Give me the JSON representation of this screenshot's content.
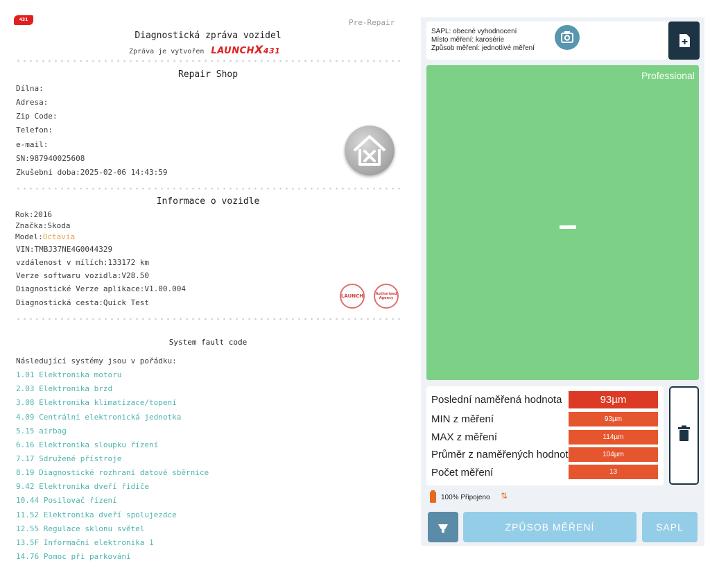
{
  "report": {
    "logo_badge": "431",
    "pre_repair": "Pre-Repair",
    "title": "Diagnostická zpráva vozidel",
    "subtitle": "Zpráva je vytvořen",
    "brand": "LAUNCH",
    "brand_x": "X",
    "brand_num": "431",
    "shop": {
      "title": "Repair Shop",
      "dilna": "Dílna:",
      "adresa": "Adresa:",
      "zip": "Zip Code:",
      "telefon": "Telefon:",
      "email": "e-mail:",
      "sn": "SN:987940025608",
      "test_time": "Zkušební doba:2025-02-06 14:43:59"
    },
    "vehicle": {
      "title": "Informace o vozidle",
      "year": "Rok:2016",
      "make": "Značka:Skoda",
      "model_label": "Model:",
      "model_value": "Octavia",
      "vin": "VIN:TMBJ37NE4G0044329",
      "distance": "vzdálenost v mílích:133172 km",
      "software": "Verze softwaru vozidla:V28.50",
      "app_version": "Diagnostické Verze aplikace:V1.00.004",
      "path": "Diagnostická cesta:Quick Test"
    },
    "stamps": [
      "LAUNCH",
      "Authorized Agency"
    ],
    "faults": {
      "title": "System fault code",
      "intro": "Následující systémy jsou v pořádku:",
      "items": [
        "1.01 Elektronika motoru",
        "2.03 Elektronika brzd",
        "3.08 Elektronika klimatizace/topení",
        "4.09 Centrální elektronická jednotka",
        "5.15 airbag",
        "6.16 Elektronika sloupku řízení",
        "7.17 Sdružené přístroje",
        "8.19 Diagnostické rozhraní datové sběrnice",
        "9.42 Elektronika dveří řidiče",
        "10.44 Posilovač řízení",
        "11.52 Elektronika dveří spolujezdce",
        "12.55 Regulace sklonu světel",
        "13.5F Informační elektronika 1",
        "14.76 Pomoc při parkování"
      ]
    }
  },
  "panel": {
    "info": {
      "line1": "SAPL: obecné vyhodnocení",
      "line2": "Místo měření: karosérie",
      "line3": "Způsob měření: jednotlivé měření"
    },
    "mode_label": "Professional",
    "current_reading": "–",
    "stats": {
      "last_label": "Poslední naměřená hodnota",
      "last_value": "93µm",
      "min_label": "MIN z měření",
      "min_value": "93µm",
      "max_label": "MAX z měření",
      "max_value": "114µm",
      "avg_label": "Průměr z naměřených hodnot",
      "avg_value": "104µm",
      "count_label": "Počet měření",
      "count_value": "13"
    },
    "connection": "100% Připojeno",
    "buttons": {
      "method": "ZPŮSOB MĚŘENÍ",
      "sapl": "SAPL"
    }
  },
  "colors": {
    "accent_red": "#dc3a24",
    "stat_orange": "#e5552e",
    "green_area": "#7dd186",
    "dark_button": "#1c3444",
    "light_button": "#94cde7",
    "fault_teal": "#4fb4b0"
  }
}
